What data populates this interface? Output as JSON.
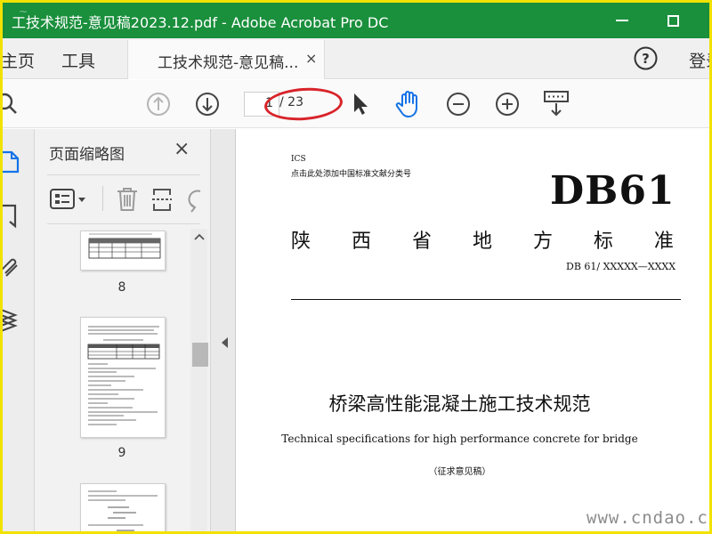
{
  "window": {
    "title": "工技术规范-意见稿2023.12.pdf - Adobe Acrobat Pro DC"
  },
  "tabbar": {
    "home": "主页",
    "tools": "工具",
    "doc_tab_label": "工技术规范-意见稿...",
    "doc_tab_close": "×",
    "login": "登录"
  },
  "toolbar": {
    "current_page": "1",
    "total_pages": "/ 23"
  },
  "thumbnails_panel": {
    "title": "页面缩略图",
    "close": "×",
    "pages": [
      {
        "number": "8"
      },
      {
        "number": "9"
      }
    ]
  },
  "document": {
    "ics": "ICS",
    "classification_hint": "点击此处添加中国标准文献分类号",
    "std_prefix": "DB61",
    "province_standard_chars": [
      "陕",
      "西",
      "省",
      "地",
      "方",
      "标",
      "准"
    ],
    "std_code": "DB 61/ XXXXX—XXXX",
    "title_cn": "桥梁高性能混凝土施工技术规范",
    "title_en": "Technical specifications for high performance concrete for bridge",
    "draft_note": "（征求意见稿）"
  },
  "watermark": {
    "bottom_right": "www.cndao.com"
  },
  "colors": {
    "titlebar": "#1a8f3c",
    "frame": "#f2e200",
    "annotation": "#d8232a",
    "hand_tool": "#1473e6"
  }
}
